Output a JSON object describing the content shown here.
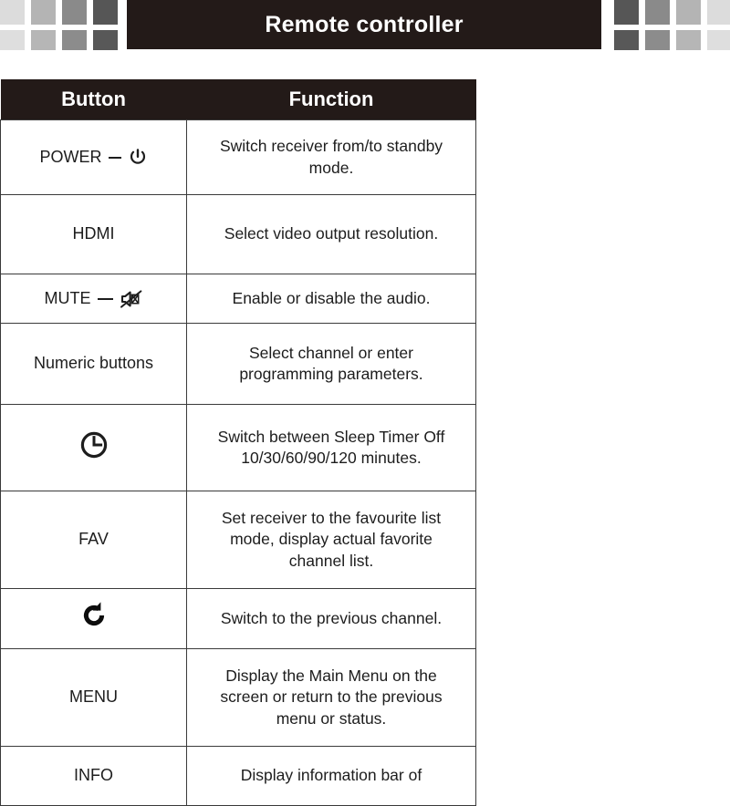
{
  "header": {
    "title": "Remote controller",
    "bar_color": "#231a18",
    "decor_squares": {
      "left_row1": [
        "#dcdcdc",
        "#b4b4b4",
        "#8a8a8a",
        "#565656"
      ],
      "left_row2": [
        "#dedede",
        "#b6b6b6",
        "#8c8c8c",
        "#585858"
      ],
      "right_row1": [
        "#565656",
        "#8a8a8a",
        "#b4b4b4",
        "#dcdcdc"
      ],
      "right_row2": [
        "#585858",
        "#8c8c8c",
        "#b6b6b6",
        "#dedede"
      ]
    }
  },
  "table": {
    "columns": [
      "Button",
      "Function"
    ],
    "rows": [
      {
        "button_label": "POWER",
        "button_icon": "power-icon",
        "separator": "dash",
        "function": "Switch receiver from/to standby mode."
      },
      {
        "button_label": "HDMI",
        "button_icon": null,
        "separator": null,
        "function": "Select video output resolution."
      },
      {
        "button_label": "MUTE",
        "button_icon": "mute-speaker-icon",
        "separator": "dash",
        "function": "Enable or disable the audio."
      },
      {
        "button_label": "Numeric buttons",
        "button_icon": null,
        "separator": null,
        "function": "Select channel or enter programming parameters."
      },
      {
        "button_label": "",
        "button_icon": "clock-icon",
        "separator": null,
        "function": "Switch between Sleep Timer Off 10/30/60/90/120 minutes."
      },
      {
        "button_label": "FAV",
        "button_icon": null,
        "separator": null,
        "function": "Set receiver to the favourite list mode, display actual favorite channel list."
      },
      {
        "button_label": "",
        "button_icon": "refresh-icon",
        "separator": null,
        "function": "Switch to the previous channel."
      },
      {
        "button_label": "MENU",
        "button_icon": null,
        "separator": null,
        "function": "Display the Main Menu on the screen or return to the previous menu or status."
      },
      {
        "button_label": "INFO",
        "button_icon": null,
        "separator": null,
        "function": "Display information bar of"
      }
    ]
  }
}
